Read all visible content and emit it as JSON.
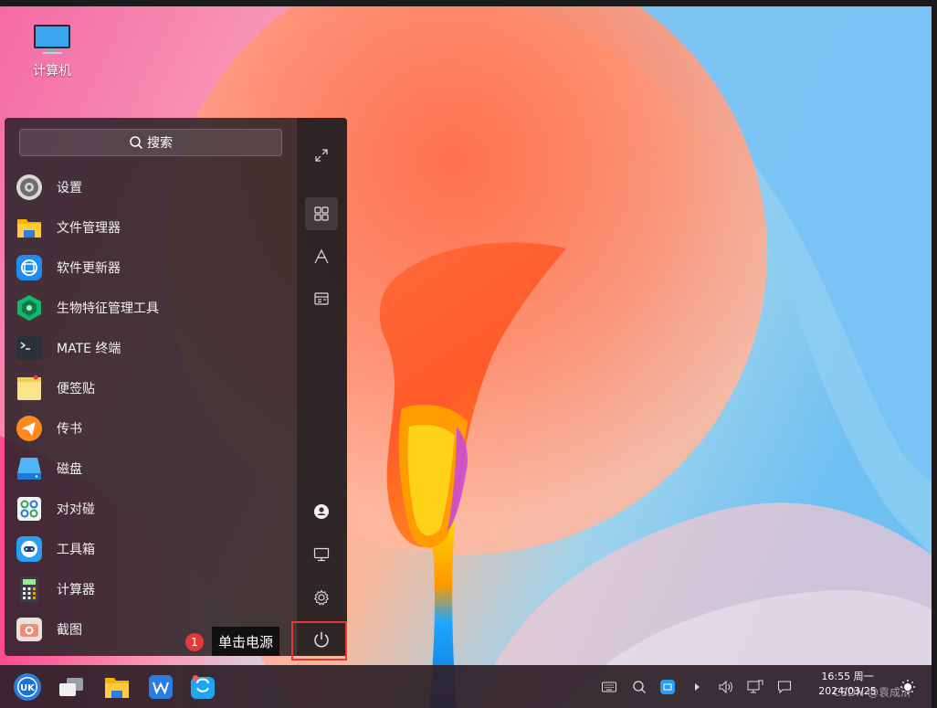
{
  "desktop": {
    "icons": [
      {
        "label": "计算机",
        "icon": "computer-icon"
      }
    ]
  },
  "start_menu": {
    "search": {
      "label": "搜索",
      "icon": "search-icon"
    },
    "apps": [
      {
        "label": "设置",
        "icon": "settings-app-icon"
      },
      {
        "label": "文件管理器",
        "icon": "file-manager-icon"
      },
      {
        "label": "软件更新器",
        "icon": "software-updater-icon"
      },
      {
        "label": "生物特征管理工具",
        "icon": "biometric-icon"
      },
      {
        "label": "MATE 终端",
        "icon": "terminal-icon"
      },
      {
        "label": "便签贴",
        "icon": "sticky-note-icon"
      },
      {
        "label": "传书",
        "icon": "messenger-icon"
      },
      {
        "label": "磁盘",
        "icon": "disk-icon"
      },
      {
        "label": "对对碰",
        "icon": "game-icon"
      },
      {
        "label": "工具箱",
        "icon": "toolbox-icon"
      },
      {
        "label": "计算器",
        "icon": "calculator-icon"
      },
      {
        "label": "截图",
        "icon": "screenshot-icon"
      }
    ],
    "sidebar": {
      "top": [
        "expand-icon",
        "all-apps-icon",
        "letter-sort-icon",
        "category-icon"
      ],
      "bottom": [
        "user-icon",
        "computer-icon",
        "settings-icon",
        "power-icon"
      ]
    }
  },
  "annotation": {
    "number": "1",
    "text": "单击电源",
    "color": "#e53935"
  },
  "taskbar": {
    "items": [
      "start-menu-icon",
      "workspace-icon",
      "file-manager-icon",
      "wps-icon",
      "software-store-icon"
    ],
    "tray": [
      "keyboard-icon",
      "search-icon",
      "network-icon",
      "expand-arrow-icon",
      "volume-icon",
      "network-status-icon",
      "notification-icon"
    ],
    "clock": {
      "time": "16:55 周一",
      "date": "2024/03/25"
    },
    "watermark": "CSDN @袁成浒"
  }
}
